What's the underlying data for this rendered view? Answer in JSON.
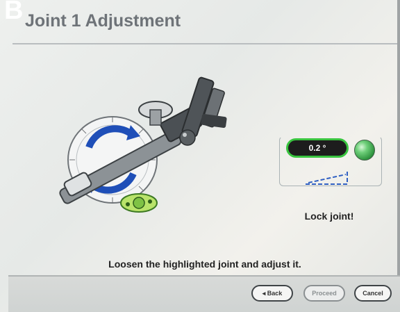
{
  "screen": {
    "corner_label": "B",
    "title": "Joint 1 Adjustment"
  },
  "readout": {
    "angle_value": "0.2 °",
    "status_color": "#3aa34a",
    "pill_border_color": "#39c43f",
    "lock_message": "Lock joint!"
  },
  "instruction": "Loosen the highlighted joint and adjust it.",
  "footer": {
    "back_label": "◂ Back",
    "proceed_label": "Proceed",
    "cancel_label": "Cancel"
  },
  "icons": {
    "instrument": "joint-adjustment-illustration-icon",
    "level": "level-indicator-icon",
    "status": "status-led-icon"
  }
}
